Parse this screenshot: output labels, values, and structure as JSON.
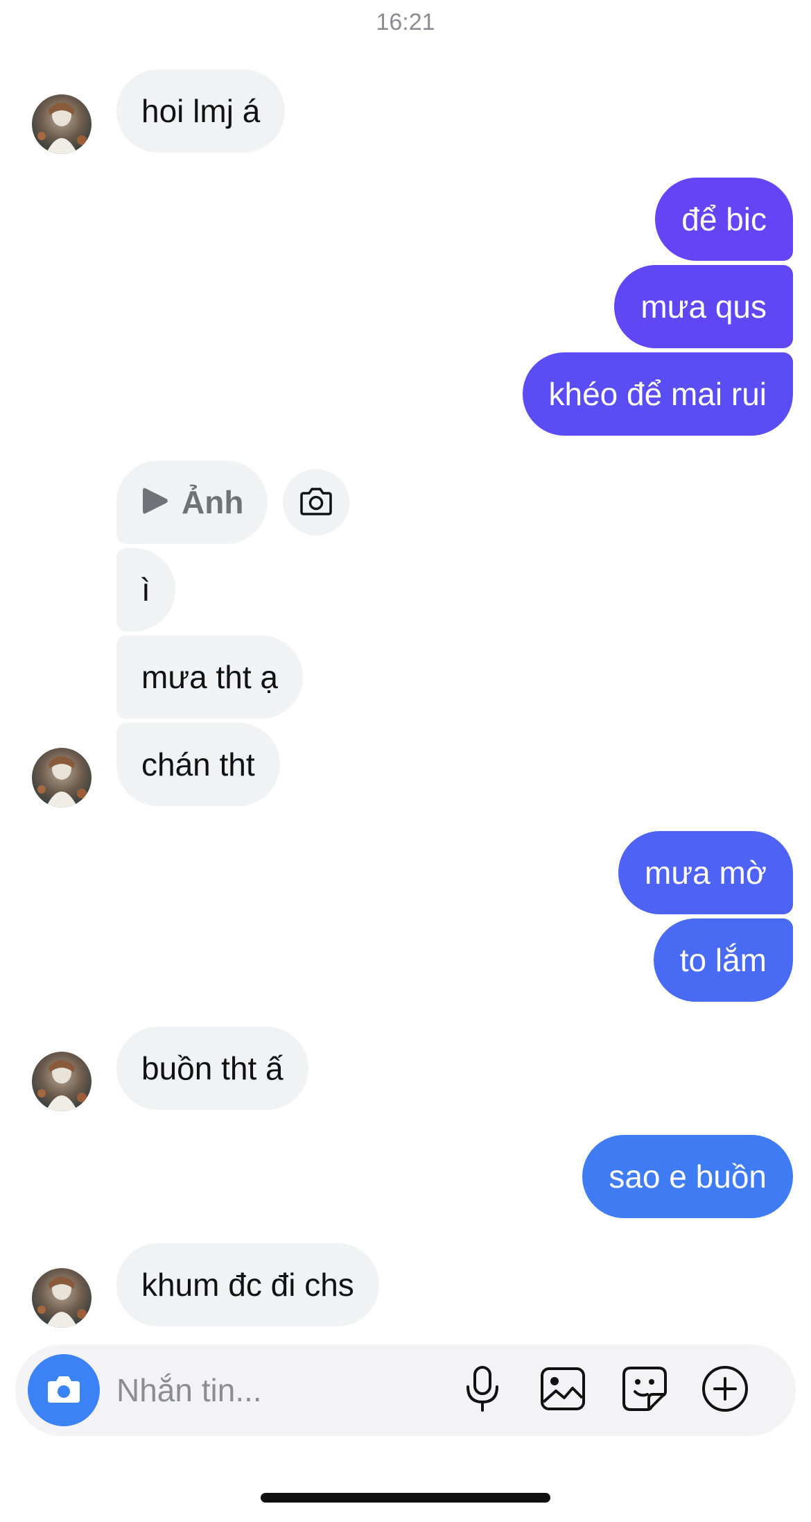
{
  "header": {
    "time": "16:21"
  },
  "messages": [
    {
      "id": "m1",
      "direction": "incoming",
      "text": "hoi lmj á"
    },
    {
      "id": "m2",
      "direction": "outgoing",
      "text": "để bic",
      "color": "#6544f5"
    },
    {
      "id": "m3",
      "direction": "outgoing",
      "text": "mưa qus",
      "color": "#6047f4"
    },
    {
      "id": "m4",
      "direction": "outgoing",
      "text": "khéo để mai rui",
      "color": "#5a4df4"
    },
    {
      "id": "m5",
      "direction": "incoming",
      "type": "media",
      "text": "Ảnh",
      "icon": "play-icon"
    },
    {
      "id": "m6",
      "direction": "incoming",
      "text": "ì"
    },
    {
      "id": "m7",
      "direction": "incoming",
      "text": "mưa tht ạ"
    },
    {
      "id": "m8",
      "direction": "incoming",
      "text": "chán tht"
    },
    {
      "id": "m9",
      "direction": "outgoing",
      "text": "mưa mờ",
      "color": "#4e62f3"
    },
    {
      "id": "m10",
      "direction": "outgoing",
      "text": "to lắm",
      "color": "#496af3"
    },
    {
      "id": "m11",
      "direction": "incoming",
      "text": "buồn tht ấ"
    },
    {
      "id": "m12",
      "direction": "outgoing",
      "text": "sao e buồn",
      "color": "#3f7cf3"
    },
    {
      "id": "m13",
      "direction": "incoming",
      "text": "khum đc đi chs"
    }
  ],
  "media_action": {
    "icon": "camera-icon"
  },
  "composer": {
    "placeholder": "Nhắn tin...",
    "value": "",
    "icons": [
      "camera-icon",
      "microphone-icon",
      "gallery-icon",
      "sticker-icon",
      "plus-circle-icon"
    ],
    "accent": "#3b82f6"
  },
  "colors": {
    "incoming_bubble": "#f1f2f4",
    "incoming_text": "#111111",
    "outgoing_text": "#ffffff",
    "timestamp": "#8a8d91"
  }
}
